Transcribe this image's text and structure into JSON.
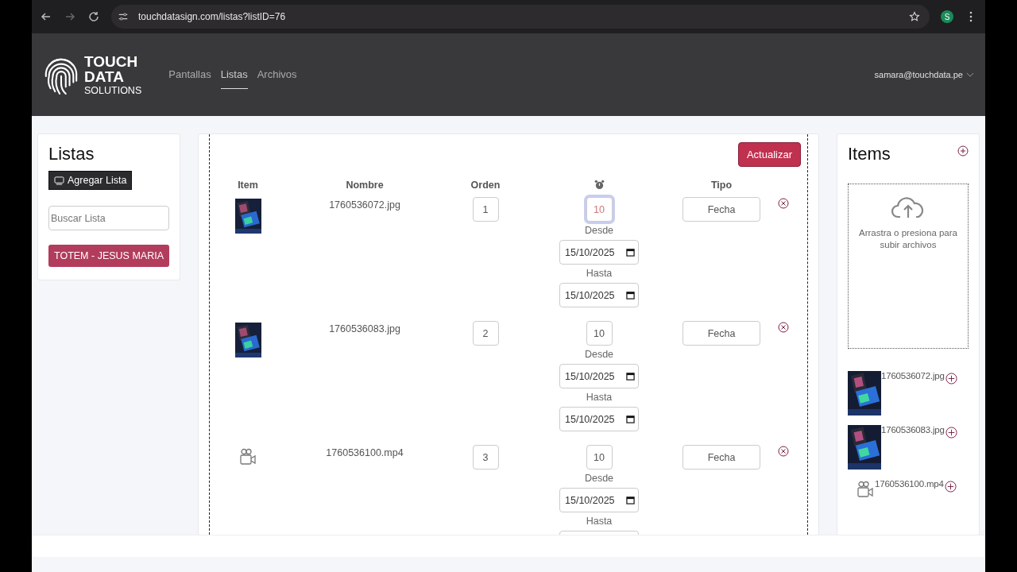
{
  "browser": {
    "url": "touchdatasign.com/listas?listID=76",
    "profile_initial": "S"
  },
  "header": {
    "logo_lines": [
      "TOUCH",
      "DATA",
      "SOLUTIONS"
    ],
    "nav": [
      {
        "label": "Pantallas",
        "selected": false
      },
      {
        "label": "Listas",
        "selected": true
      },
      {
        "label": "Archivos",
        "selected": false
      }
    ],
    "user": "samara@touchdata.pe"
  },
  "sidebar": {
    "title": "Listas",
    "add_button": "Agregar Lista",
    "search": {
      "placeholder": "Buscar Lista"
    },
    "lists": [
      {
        "label": "TOTEM - JESUS MARIA"
      }
    ]
  },
  "main": {
    "update_button": "Actualizar",
    "columns": [
      "Item",
      "Nombre",
      "Orden",
      null,
      "Tipo"
    ],
    "rows": [
      {
        "name": "1760536072.jpg",
        "order": "1",
        "duration": "10",
        "focused": true,
        "desde_label": "Desde",
        "desde": "15/10/2025",
        "hasta_label": "Hasta",
        "hasta": "15/10/2025",
        "type": "Fecha"
      },
      {
        "name": "1760536083.jpg",
        "order": "2",
        "duration": "10",
        "focused": false,
        "desde_label": "Desde",
        "desde": "15/10/2025",
        "hasta_label": "Hasta",
        "hasta": "15/10/2025",
        "type": "Fecha"
      },
      {
        "kind": "video",
        "name": "1760536100.mp4",
        "order": "3",
        "duration": "10",
        "focused": false,
        "desde_label": "Desde",
        "desde": "15/10/2025",
        "hasta_label": "Hasta",
        "type": "Fecha"
      }
    ]
  },
  "items": {
    "title": "Items",
    "upload_text": "Arrastra o presiona para subir archivos",
    "files": [
      {
        "name": "1760536072.jpg"
      },
      {
        "name": "1760536083.jpg"
      },
      {
        "kind": "video",
        "name": "1760536100.mp4"
      }
    ]
  }
}
